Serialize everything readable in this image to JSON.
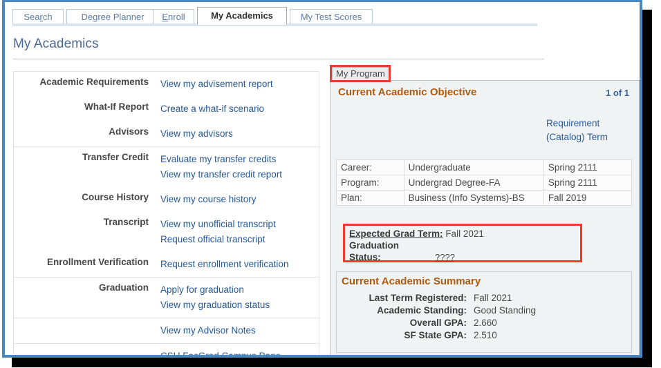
{
  "window": {
    "frame_color": "#4a89c0"
  },
  "tabs": [
    {
      "label": "Search",
      "accesskey": "r",
      "active": false
    },
    {
      "label": "Degree Planner",
      "accesskey": "",
      "active": false
    },
    {
      "label": "Enroll",
      "accesskey": "E",
      "active": false
    },
    {
      "label": "My Academics",
      "accesskey": "",
      "active": true
    },
    {
      "label": "My Test Scores",
      "accesskey": "",
      "active": false
    }
  ],
  "page": {
    "title": "My Academics"
  },
  "left_panel": {
    "groups": [
      {
        "rows": [
          {
            "label": "Academic Requirements",
            "links": [
              "View my advisement report"
            ]
          },
          {
            "label": "What-If Report",
            "links": [
              "Create a what-if scenario"
            ]
          },
          {
            "label": "Advisors",
            "links": [
              "View my advisors"
            ]
          }
        ]
      },
      {
        "rows": [
          {
            "label": "Transfer Credit",
            "links": [
              "Evaluate my transfer credits",
              "View my transfer credit report"
            ]
          },
          {
            "label": "Course History",
            "links": [
              "View my course history"
            ]
          },
          {
            "label": "Transcript",
            "links": [
              "View my unofficial transcript",
              "Request official transcript"
            ]
          },
          {
            "label": "Enrollment Verification",
            "links": [
              "Request enrollment verification"
            ]
          }
        ]
      },
      {
        "rows": [
          {
            "label": "Graduation",
            "links": [
              "Apply for graduation",
              "View my graduation status"
            ]
          }
        ]
      },
      {
        "rows": [
          {
            "label": "",
            "links": [
              "View my Advisor Notes"
            ]
          }
        ]
      },
      {
        "rows": [
          {
            "label": "",
            "links": [
              "CSU FacGrad Campus Page"
            ]
          }
        ]
      }
    ]
  },
  "right_panel": {
    "tab_label": "My Program",
    "highlight_color": "#ef3b2d",
    "objective": {
      "title": "Current Academic Objective",
      "count": "1 of 1",
      "requirement_term_header_line1": "Requirement",
      "requirement_term_header_line2": "(Catalog) Term",
      "table": {
        "rows": [
          {
            "key": "Career:",
            "value": "Undergraduate",
            "term": "Spring 2111"
          },
          {
            "key": "Program:",
            "value": "Undergrad Degree-FA",
            "term": "Spring 2111"
          },
          {
            "key": "Plan:",
            "value": "Business (Info Systems)-BS",
            "term": "Fall 2019"
          }
        ]
      }
    },
    "grad_box": {
      "expected_term_label": "Expected Grad Term:",
      "expected_term_value": "Fall 2021",
      "status_label_line1": "Graduation",
      "status_label_line2": "Status:",
      "status_value": "????"
    },
    "summary": {
      "title": "Current Academic Summary",
      "rows": [
        {
          "key": "Last Term Registered:",
          "value": "Fall 2021"
        },
        {
          "key": "Academic Standing:",
          "value": "Good Standing"
        },
        {
          "key": "Overall GPA:",
          "value": "2.660"
        },
        {
          "key": "SF State GPA:",
          "value": "2.510"
        }
      ]
    }
  }
}
